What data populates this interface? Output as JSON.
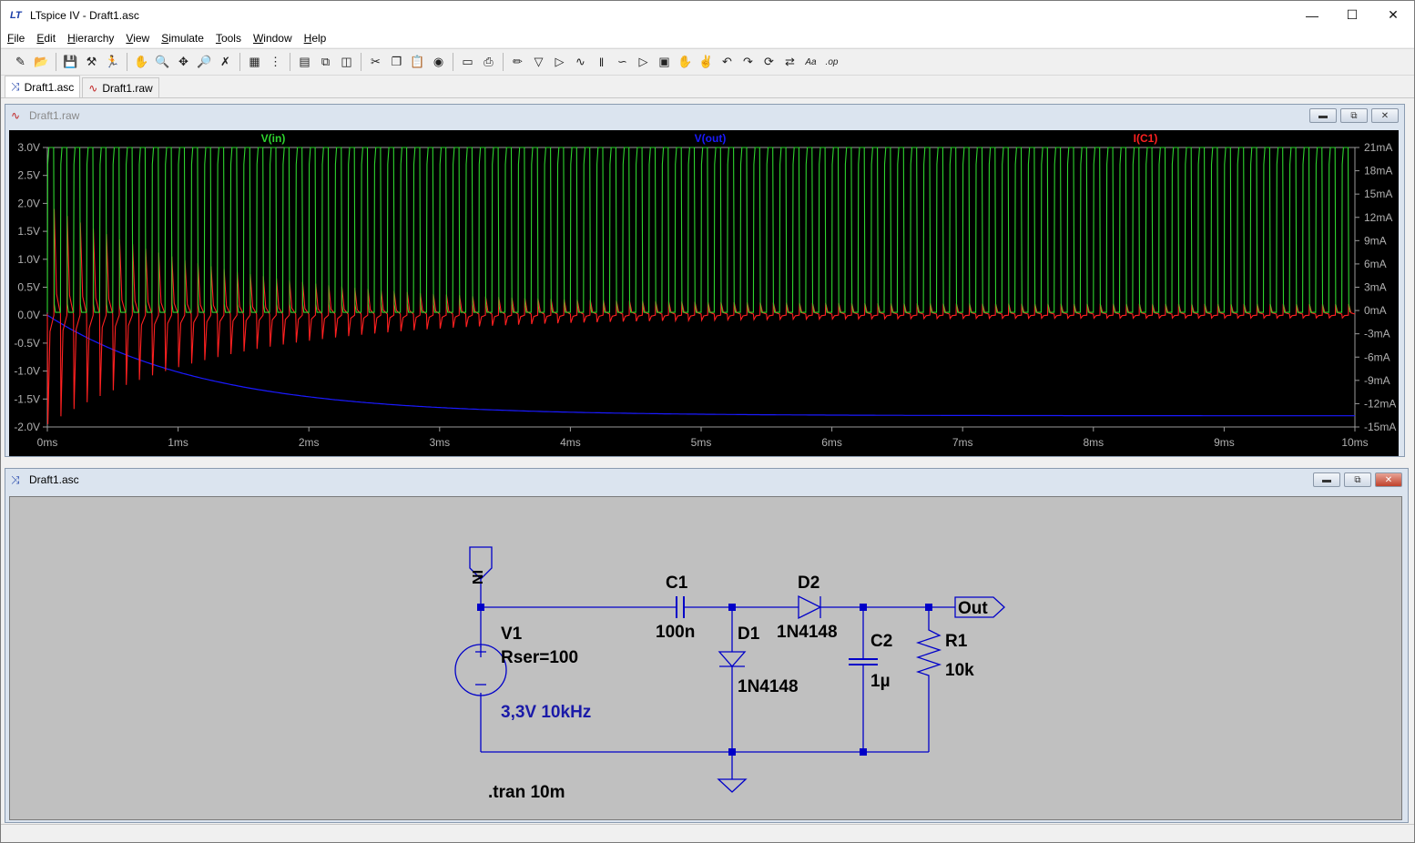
{
  "window": {
    "app_icon": "LT",
    "title": "LTspice IV - Draft1.asc"
  },
  "menu": [
    {
      "label": "File",
      "u": "F",
      "rest": "ile"
    },
    {
      "label": "Edit",
      "u": "E",
      "rest": "dit"
    },
    {
      "label": "Hierarchy",
      "u": "H",
      "rest": "ierarchy"
    },
    {
      "label": "View",
      "u": "V",
      "rest": "iew"
    },
    {
      "label": "Simulate",
      "u": "S",
      "rest": "imulate"
    },
    {
      "label": "Tools",
      "u": "T",
      "rest": "ools"
    },
    {
      "label": "Window",
      "u": "W",
      "rest": "indow"
    },
    {
      "label": "Help",
      "u": "H",
      "rest": "elp"
    }
  ],
  "toolbar": [
    "new-schematic",
    "open",
    "save",
    "control-panel",
    "run",
    "halt",
    "zoom-in",
    "pan",
    "zoom-out",
    "zoom-cancel",
    "autorange",
    "mark-units",
    "tile-horizontal",
    "cascade",
    "tile-vertical",
    "cut",
    "copy",
    "paste",
    "find",
    "print-setup",
    "print",
    "draw-wire",
    "ground",
    "label-net",
    "resistor",
    "capacitor",
    "inductor",
    "diode",
    "component",
    "move",
    "drag",
    "undo",
    "redo",
    "rotate",
    "mirror",
    "text",
    "spice-directive"
  ],
  "tabs": [
    {
      "label": "Draft1.asc",
      "icon": "schematic-icon",
      "active": true
    },
    {
      "label": "Draft1.raw",
      "icon": "waveform-icon",
      "active": false
    }
  ],
  "plot_window": {
    "title": "Draft1.raw"
  },
  "schematic_window": {
    "title": "Draft1.asc"
  },
  "chart_data": {
    "type": "line",
    "x_unit": "s",
    "xlim": [
      0,
      10
    ],
    "x_ticks": [
      "0ms",
      "1ms",
      "2ms",
      "3ms",
      "4ms",
      "5ms",
      "6ms",
      "7ms",
      "8ms",
      "9ms",
      "10ms"
    ],
    "ylim_left": [
      -2.0,
      3.0
    ],
    "y_ticks_left": [
      "3.0V",
      "2.5V",
      "2.0V",
      "1.5V",
      "1.0V",
      "0.5V",
      "0.0V",
      "-0.5V",
      "-1.0V",
      "-1.5V",
      "-2.0V"
    ],
    "ylim_right": [
      -15,
      21
    ],
    "y_ticks_right": [
      "21mA",
      "18mA",
      "15mA",
      "12mA",
      "9mA",
      "6mA",
      "3mA",
      "0mA",
      "-3mA",
      "-6mA",
      "-9mA",
      "-12mA",
      "-15mA"
    ],
    "series": [
      {
        "name": "V(in)",
        "color": "#2ed52e",
        "axis": "left",
        "shape": "square-wave",
        "period_ms": 0.1,
        "high": 3.0,
        "low": 0.05
      },
      {
        "name": "V(out)",
        "color": "#1a1aff",
        "axis": "left",
        "shape": "exponential-decay",
        "start": 0.0,
        "final": -1.8,
        "tau_ms": 1.2
      },
      {
        "name": "I(C1)",
        "color": "#ff2020",
        "axis": "left",
        "shape": "spikes",
        "period_ms": 0.1,
        "initial_neg": -1.95,
        "initial_pos": 1.9,
        "final_neg": -0.05,
        "final_pos": 0.2
      }
    ]
  },
  "schematic": {
    "components": {
      "in_label": "IN",
      "v1": {
        "name": "V1",
        "param": "Rser=100",
        "value": "3,3V 10kHz"
      },
      "c1": {
        "name": "C1",
        "value": "100n"
      },
      "d1": {
        "name": "D1",
        "value": "1N4148"
      },
      "d2": {
        "name": "D2",
        "value": "1N4148"
      },
      "c2": {
        "name": "C2",
        "value": "1µ"
      },
      "r1": {
        "name": "R1",
        "value": "10k"
      },
      "out_label": "Out"
    },
    "directive": ".tran 10m",
    "wire_color": "#0000c8",
    "text_color_value": "#1a1aa8"
  }
}
